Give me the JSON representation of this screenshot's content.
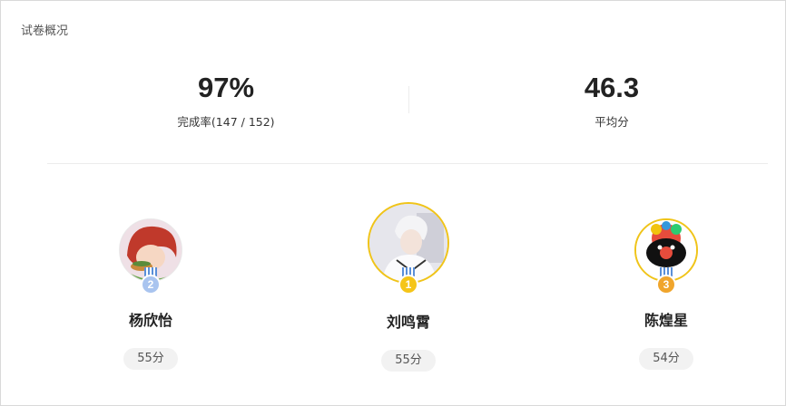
{
  "page": {
    "title": "试卷概况"
  },
  "stats": {
    "completion": {
      "value": "97%",
      "label": "完成率(147 / 152)"
    },
    "average": {
      "value": "46.3",
      "label": "平均分"
    }
  },
  "ranking": [
    {
      "rank": "2",
      "name": "杨欣怡",
      "score": "55分",
      "badge_color": "#a9c4ef"
    },
    {
      "rank": "1",
      "name": "刘鸣霄",
      "score": "55分",
      "badge_color": "#f5c518"
    },
    {
      "rank": "3",
      "name": "陈煌星",
      "score": "54分",
      "badge_color": "#f0a52c"
    }
  ],
  "colors": {
    "gold_ring": "#f0c419",
    "divider": "#ececec"
  }
}
